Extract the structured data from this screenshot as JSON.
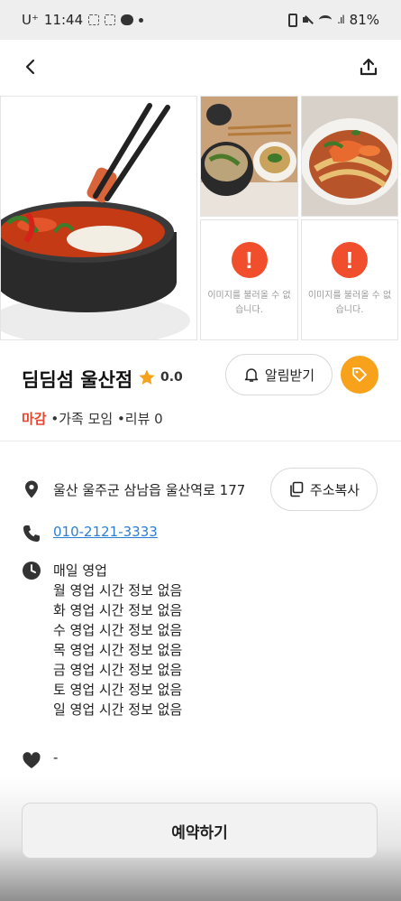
{
  "status_bar": {
    "carrier": "U⁺",
    "time": "11:44",
    "battery": "81%"
  },
  "gallery": {
    "error_text": "이미지를 불러올 수 없습니다.",
    "error_mark": "!"
  },
  "store": {
    "name": "딤딤섬 울산점",
    "rating": "0.0",
    "notify_label": "알림받기",
    "status_closed": "마감",
    "meta": " •가족 모임 •리뷰 0"
  },
  "info": {
    "address": "울산 울주군 삼남읍 울산역로 177",
    "copy_label": "주소복사",
    "phone": "010-2121-3333",
    "hours": [
      "매일 영업",
      "월 영업 시간 정보 없음",
      "화 영업 시간 정보 없음",
      "수 영업 시간 정보 없음",
      "목 영업 시간 정보 없음",
      "금 영업 시간 정보 없음",
      "토 영업 시간 정보 없음",
      "일 영업 시간 정보 없음"
    ],
    "favorite": "-"
  },
  "actions": {
    "reserve_label": "예약하기"
  },
  "colors": {
    "accent": "#f8a21c",
    "closed": "#e8452f",
    "link": "#2a7fd4",
    "error": "#f04e2c"
  },
  "icons": [
    "back-arrow-icon",
    "share-icon",
    "star-icon",
    "bell-icon",
    "tag-icon",
    "location-pin-icon",
    "copy-icon",
    "phone-icon",
    "clock-icon",
    "heart-icon",
    "error-icon"
  ]
}
